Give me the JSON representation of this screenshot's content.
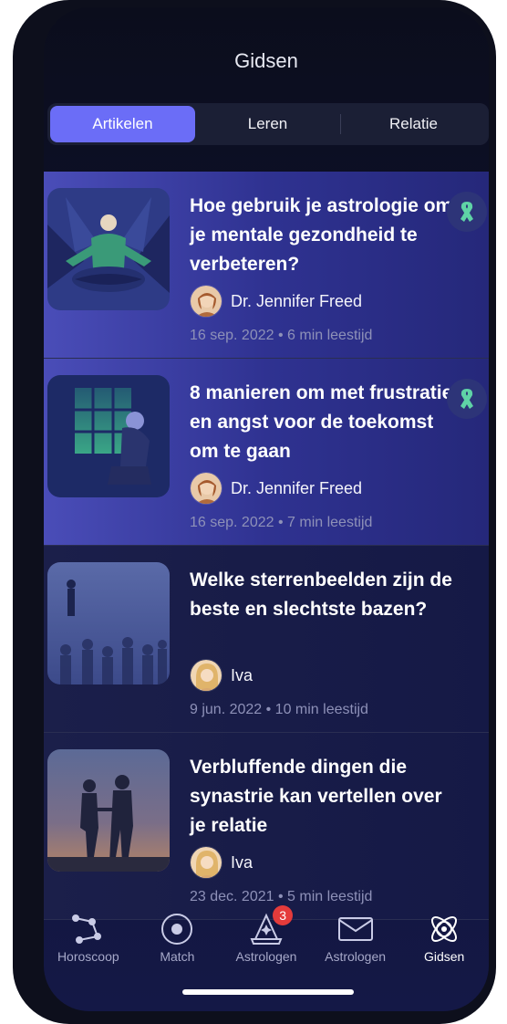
{
  "header": {
    "title": "Gidsen"
  },
  "tabs": [
    {
      "label": "Artikelen",
      "active": true
    },
    {
      "label": "Leren",
      "active": false
    },
    {
      "label": "Relatie",
      "active": false
    }
  ],
  "articles": [
    {
      "title": "Hoe gebruik je astrologie om je mentale gezondheid te verbeteren?",
      "author": "Dr. Jennifer Freed",
      "meta": "16 sep. 2022 • 6 min leestijd",
      "ribbon": "awareness-ribbon-icon"
    },
    {
      "title": "8 manieren om met frustratie en angst voor de toekomst om te gaan",
      "author": "Dr. Jennifer Freed",
      "meta": "16 sep. 2022 • 7 min leestijd",
      "ribbon": "awareness-ribbon-icon"
    },
    {
      "title": "Welke sterrenbeelden zijn de beste en slechtste bazen?",
      "author": "Iva",
      "meta": "9 jun. 2022 • 10 min leestijd"
    },
    {
      "title": "Verbluffende dingen die synastrie kan vertellen over je relatie",
      "author": "Iva",
      "meta": "23 dec. 2021 • 5 min leestijd"
    }
  ],
  "tabbar": [
    {
      "label": "Horoscoop",
      "icon": "constellation-icon"
    },
    {
      "label": "Match",
      "icon": "orbit-icon"
    },
    {
      "label": "Astrologen",
      "icon": "wizard-hat-icon",
      "badge": "3"
    },
    {
      "label": "Astrologen",
      "icon": "envelope-icon"
    },
    {
      "label": "Gidsen",
      "icon": "atom-icon",
      "active": true
    }
  ],
  "colors": {
    "accent": "#6b6df7",
    "ribbon": "#5fd3a6",
    "badge": "#e53b3b"
  }
}
